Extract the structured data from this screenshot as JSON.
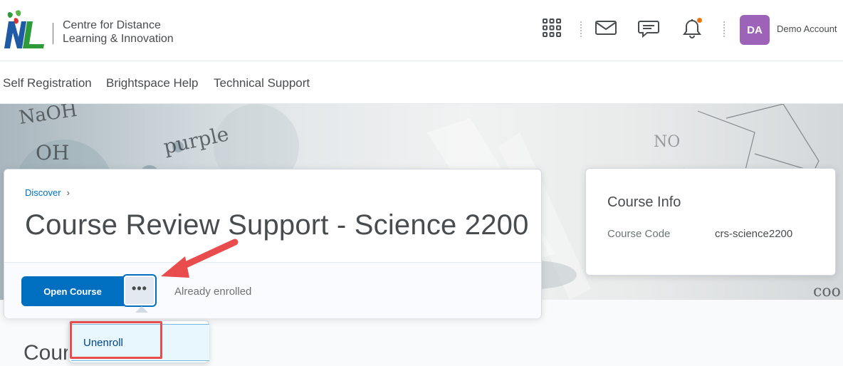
{
  "header": {
    "org_name_line1": "Centre for Distance",
    "org_name_line2": "Learning & Innovation",
    "account": {
      "initials": "DA",
      "name": "Demo Account",
      "avatar_color": "#9d63b8"
    },
    "icons": [
      "grid-icon",
      "mail-icon",
      "chat-icon",
      "bell-icon"
    ],
    "notification_dot_color": "#e87511"
  },
  "navbar": {
    "links": [
      "Self Registration",
      "Brightspace Help",
      "Technical Support"
    ]
  },
  "course": {
    "breadcrumb": "Discover",
    "title": "Course Review Support - Science 2200",
    "open_button": "Open Course",
    "more_button": "•••",
    "status": "Already enrolled",
    "accent_color": "#006fbf"
  },
  "dropdown": {
    "items": [
      "Unenroll"
    ]
  },
  "course_info": {
    "title": "Course Info",
    "code_label": "Course Code",
    "code_value": "crs-science2200"
  },
  "section": {
    "heading": "Course"
  },
  "banner": {
    "notes": [
      "NaOH",
      "OH",
      "purple",
      "NO",
      "coo"
    ]
  },
  "annotation_color": "#e84c4c"
}
